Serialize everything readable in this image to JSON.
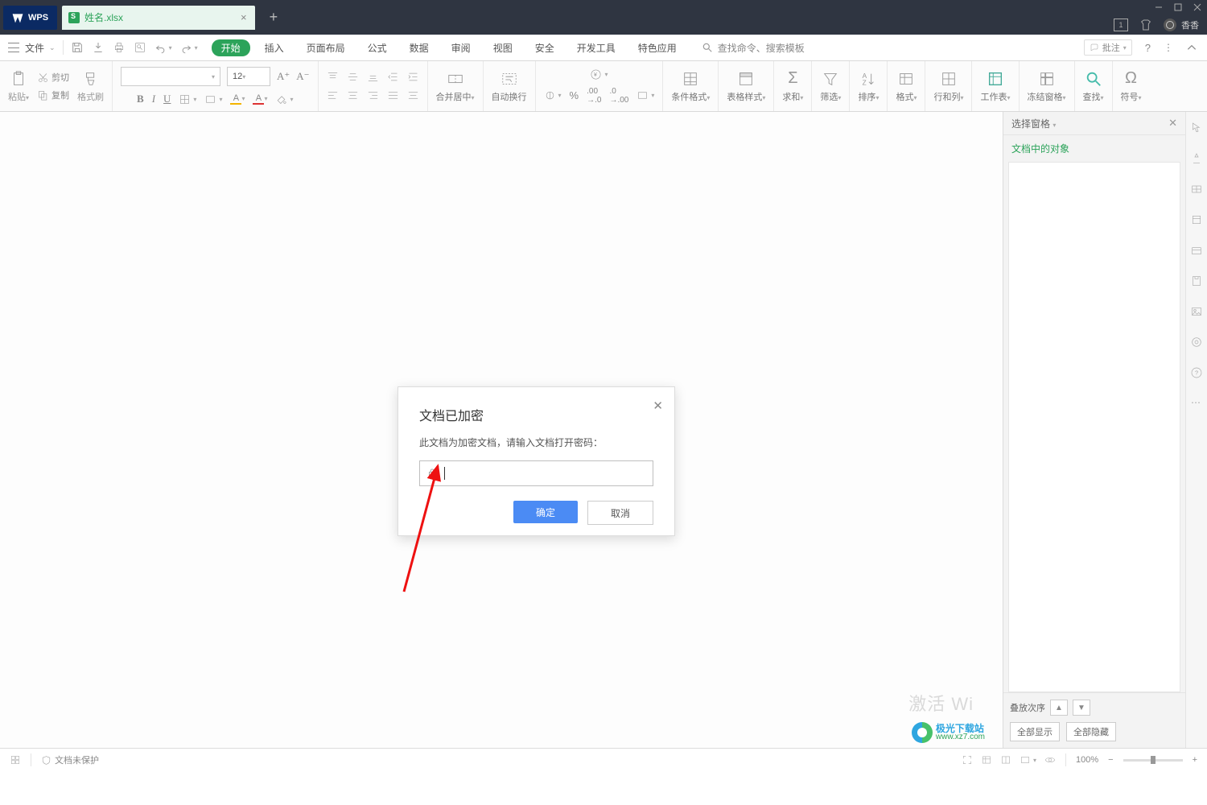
{
  "titlebar": {
    "wps": "WPS",
    "file_tab": "姓名.xlsx",
    "close": "×",
    "add": "+",
    "notif": "1",
    "user": "香香"
  },
  "menu": {
    "file": "文件",
    "tabs": [
      "开始",
      "插入",
      "页面布局",
      "公式",
      "数据",
      "审阅",
      "视图",
      "安全",
      "开发工具",
      "特色应用"
    ],
    "search": "查找命令、搜索模板",
    "annotate": "批注"
  },
  "ribbon": {
    "paste": "粘贴",
    "cut": "剪切",
    "copy": "复制",
    "format_painter": "格式刷",
    "font_name": "",
    "font_size": "12",
    "merge": "合并居中",
    "wrap": "自动换行",
    "condfmt": "条件格式",
    "tablestyle": "表格样式",
    "sum": "求和",
    "filter": "筛选",
    "sort": "排序",
    "format": "格式",
    "rowscols": "行和列",
    "worksheet": "工作表",
    "freeze": "冻结窗格",
    "find": "查找",
    "symbol": "符号"
  },
  "sidepanel": {
    "title": "选择窗格",
    "subtitle": "文档中的对象",
    "order": "叠放次序",
    "show_all": "全部显示",
    "hide_all": "全部隐藏"
  },
  "dialog": {
    "title": "文档已加密",
    "message": "此文档为加密文档，请输入文档打开密码：",
    "ok": "确定",
    "cancel": "取消"
  },
  "status": {
    "protect": "文档未保护",
    "zoom": "100%",
    "activate": "激活 Wi"
  },
  "logo": {
    "name": "极光下载站",
    "url": "www.xz7.com"
  }
}
